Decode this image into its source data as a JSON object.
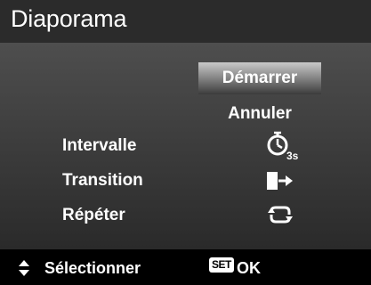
{
  "header": {
    "title": "Diaporama"
  },
  "menu": {
    "options": [
      {
        "label": "Démarrer",
        "selected": true
      },
      {
        "label": "Annuler",
        "selected": false
      }
    ]
  },
  "settings": [
    {
      "label": "Intervalle",
      "icon": "timer-3s-icon",
      "value_badge": "3s"
    },
    {
      "label": "Transition",
      "icon": "transition-icon"
    },
    {
      "label": "Répéter",
      "icon": "repeat-icon"
    }
  ],
  "footer": {
    "select_label": "Sélectionner",
    "select_icon": "up-down-arrow-icon",
    "set_badge": "SET",
    "ok_label": "OK"
  },
  "colors": {
    "accent_text": "#ffffff",
    "title_bar": "#2b2b2b",
    "panel_top": "#4e4e4e",
    "panel_bottom": "#2a2a2a"
  }
}
